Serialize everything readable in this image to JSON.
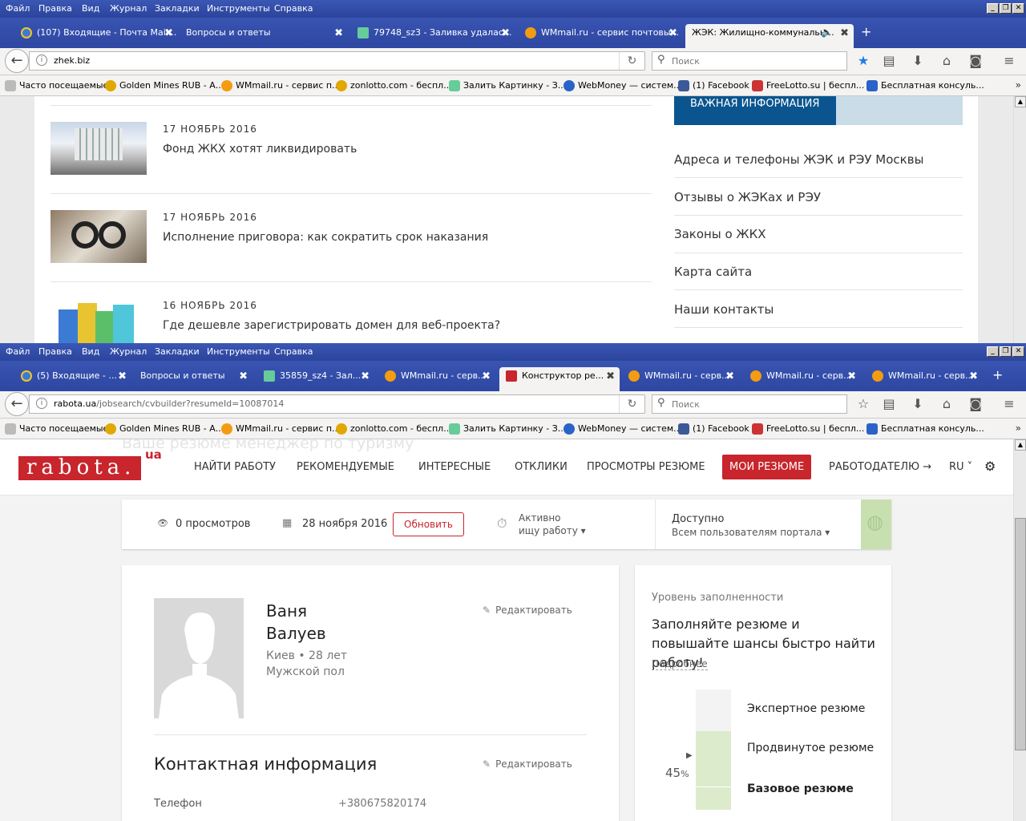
{
  "top_window": {
    "menu": [
      "Файл",
      "Правка",
      "Вид",
      "Журнал",
      "Закладки",
      "Инструменты",
      "Справка"
    ],
    "tabs": [
      {
        "label": "(107) Входящие - Почта Mail...",
        "icon": "mail-icon",
        "color": "#3a7bd5"
      },
      {
        "label": "Вопросы и ответы",
        "icon": "",
        "color": ""
      },
      {
        "label": "79748_sz3 - Заливка удалас...",
        "icon": "image-icon",
        "color": "#6c9"
      },
      {
        "label": "WMmail.ru - сервис почтовы...",
        "icon": "at-icon",
        "color": "#f39c12"
      },
      {
        "label": "ЖЭК: Жилищно-коммунальн...",
        "icon": "",
        "color": "",
        "active": true
      }
    ],
    "url": "zhek.biz",
    "search_placeholder": "Поиск",
    "bookmarks": [
      {
        "label": "Часто посещаемые",
        "color": "#888"
      },
      {
        "label": "Golden Mines RUB - А...",
        "color": "#e0a800"
      },
      {
        "label": "WMmail.ru - сервис п...",
        "color": "#f39c12"
      },
      {
        "label": "zonlotto.com - беспл...",
        "color": "#e0a800"
      },
      {
        "label": "Залить Картинку - З...",
        "color": "#6c9"
      },
      {
        "label": "WebMoney — систем...",
        "color": "#2a62c9"
      },
      {
        "label": "(1) Facebook",
        "color": "#3b5998"
      },
      {
        "label": "FreeLotto.su | беспл...",
        "color": "#c33"
      },
      {
        "label": "Бесплатная консуль...",
        "color": "#2a62c9"
      }
    ],
    "news": [
      {
        "date": "17 НОЯБРЬ 2016",
        "title": "Фонд ЖКХ хотят ликвидировать"
      },
      {
        "date": "17 НОЯБРЬ 2016",
        "title": "Исполнение приговора: как сократить срок наказания"
      },
      {
        "date": "16 НОЯБРЬ 2016",
        "title": "Где дешевле зарегистрировать домен для веб-проекта?"
      }
    ],
    "sidebar_heading": "ВАЖНАЯ ИНФОРМАЦИЯ",
    "sidebar_links": [
      "Адреса и телефоны ЖЭК и РЭУ Москвы",
      "Отзывы о ЖЭКах и РЭУ",
      "Законы о ЖКХ",
      "Карта сайта",
      "Наши контакты"
    ]
  },
  "bottom_window": {
    "menu": [
      "Файл",
      "Правка",
      "Вид",
      "Журнал",
      "Закладки",
      "Инструменты",
      "Справка"
    ],
    "tabs": [
      {
        "label": "(5) Входящие - ...",
        "color": "#3a7bd5"
      },
      {
        "label": "Вопросы и ответы",
        "color": ""
      },
      {
        "label": "35859_sz4 - Зал...",
        "color": "#6c9"
      },
      {
        "label": "WMmail.ru - серв...",
        "color": "#f39c12"
      },
      {
        "label": "Конструктор ре...",
        "color": "#c8252c",
        "active": true
      },
      {
        "label": "WMmail.ru - серв...",
        "color": "#f39c12"
      },
      {
        "label": "WMmail.ru - серв...",
        "color": "#f39c12"
      },
      {
        "label": "WMmail.ru - серв...",
        "color": "#f39c12"
      }
    ],
    "url_host": "rabota.ua",
    "url_path": "/jobsearch/cvbuilder?resumeId=10087014",
    "search_placeholder": "Поиск",
    "ghost_title": "Ваше резюме  менеджер по туризму",
    "logo": "rabota.",
    "logo_suffix": "ua",
    "nav": [
      "НАЙТИ РАБОТУ",
      "РЕКОМЕНДУЕМЫЕ",
      "ИНТЕРЕСНЫЕ",
      "ОТКЛИКИ",
      "ПРОСМОТРЫ РЕЗЮМЕ",
      "МОИ РЕЗЮМЕ",
      "РАБОТОДАТЕЛЮ →",
      "RU ˅"
    ],
    "stats": {
      "views": "0 просмотров",
      "date": "28 ноября 2016",
      "refresh": "Обновить",
      "status_line1": "Активно",
      "status_line2": "ищу работу",
      "access_title": "Доступно",
      "access_sub": "Всем пользователям портала"
    },
    "profile": {
      "first_name": "Ваня",
      "last_name": "Валуев",
      "meta": "Киев • 28 лет",
      "gender": "Мужской пол",
      "edit": "Редактировать"
    },
    "contact": {
      "heading": "Контактная информация",
      "edit": "Редактировать",
      "phone_label": "Телефон",
      "phone": "+380675820174"
    },
    "completeness": {
      "title": "Уровень заполненности",
      "headline": "Заполняйте резюме и повышайте шансы быстро найти работу!",
      "more": "Подробнее",
      "percent": "45",
      "percent_sign": "%",
      "levels": [
        "Экспертное резюме",
        "Продвинутое резюме",
        "Базовое резюме"
      ]
    }
  }
}
